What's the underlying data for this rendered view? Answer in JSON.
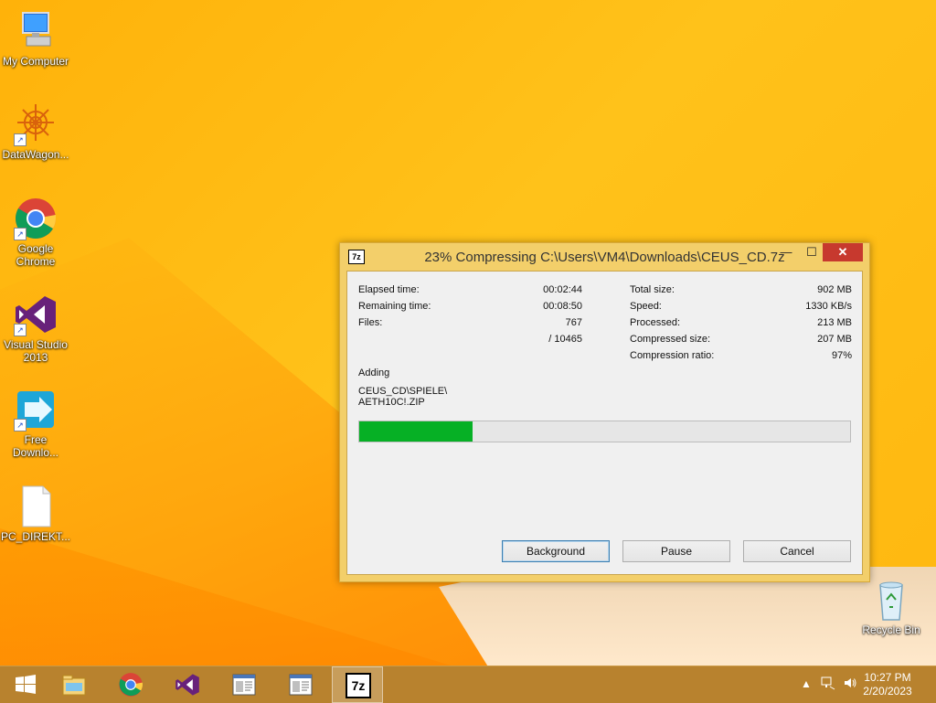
{
  "desktop": {
    "icons": [
      {
        "label": "My Computer",
        "icon": "computer-icon"
      },
      {
        "label": "DataWagon...",
        "icon": "datawagon-icon"
      },
      {
        "label": "Google\nChrome",
        "icon": "chrome-icon"
      },
      {
        "label": "Visual Studio\n2013",
        "icon": "visual-studio-icon"
      },
      {
        "label": "Free\nDownlo...",
        "icon": "free-download-icon"
      },
      {
        "label": "PC_DIREKT...",
        "icon": "file-icon"
      }
    ],
    "recycle_bin": {
      "label": "Recycle Bin",
      "icon": "recycle-bin-icon"
    }
  },
  "dialog": {
    "logo": "7z",
    "title": "23% Compressing C:\\Users\\VM4\\Downloads\\CEUS_CD.7z",
    "controls": {
      "minimize": "—",
      "maximize": "☐",
      "close": "✕"
    },
    "stats_left": [
      {
        "label": "Elapsed time:",
        "value": "00:02:44"
      },
      {
        "label": "Remaining time:",
        "value": "00:08:50"
      },
      {
        "label": "Files:",
        "value": "767"
      },
      {
        "label": "",
        "value": "/ 10465"
      }
    ],
    "stats_right": [
      {
        "label": "Total size:",
        "value": "902 MB"
      },
      {
        "label": "Speed:",
        "value": "1330 KB/s"
      },
      {
        "label": "Processed:",
        "value": "213 MB"
      },
      {
        "label": "Compressed size:",
        "value": "207 MB"
      },
      {
        "label": "Compression ratio:",
        "value": "97%"
      }
    ],
    "action": "Adding",
    "current_file_line1": "CEUS_CD\\SPIELE\\",
    "current_file_line2": "AETH10C!.ZIP",
    "progress_fraction": 0.23,
    "progress_color": "#06b025",
    "buttons": {
      "background": "Background",
      "pause": "Pause",
      "cancel": "Cancel"
    }
  },
  "taskbar": {
    "items": [
      "start-icon",
      "file-explorer-icon",
      "chrome-icon",
      "visual-studio-icon",
      "window-icon",
      "window-icon",
      "7zip-icon"
    ],
    "active_label": "7z",
    "tray": {
      "chevron": "▲",
      "time": "10:27 PM",
      "date": "2/20/2023"
    }
  }
}
